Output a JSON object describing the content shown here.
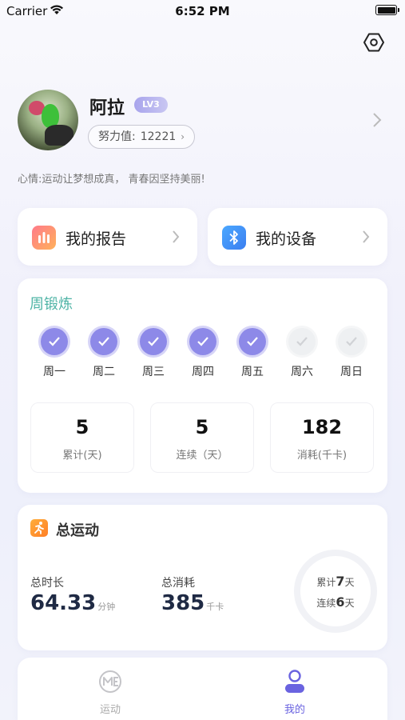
{
  "status_bar": {
    "carrier": "Carrier",
    "time": "6:52 PM"
  },
  "profile": {
    "name": "阿拉",
    "level": "LV3",
    "effort_label": "努力值:",
    "effort_value": "12221",
    "mood": "心情:运动让梦想成真， 青春因坚持美丽!"
  },
  "quick_actions": [
    {
      "label": "我的报告",
      "icon": "bar-chart-icon"
    },
    {
      "label": "我的设备",
      "icon": "bluetooth-icon"
    }
  ],
  "week": {
    "title": "周锻炼",
    "days": [
      {
        "label": "周一",
        "done": true
      },
      {
        "label": "周二",
        "done": true
      },
      {
        "label": "周三",
        "done": true
      },
      {
        "label": "周四",
        "done": true
      },
      {
        "label": "周五",
        "done": true
      },
      {
        "label": "周六",
        "done": false
      },
      {
        "label": "周日",
        "done": false
      }
    ],
    "stats": [
      {
        "value": "5",
        "label": "累计(天)"
      },
      {
        "value": "5",
        "label": "连续（天）"
      },
      {
        "value": "182",
        "label": "消耗(千卡)"
      }
    ]
  },
  "total": {
    "title": "总运动",
    "duration_label": "总时长",
    "duration_value": "64.33",
    "duration_unit": "分钟",
    "calories_label": "总消耗",
    "calories_value": "385",
    "calories_unit": "千卡",
    "ring": {
      "cumulative_prefix": "累计",
      "cumulative_value": "7",
      "cumulative_suffix": "天",
      "streak_prefix": "连续",
      "streak_value": "6",
      "streak_suffix": "天"
    }
  },
  "tabbar": {
    "items": [
      {
        "label": "运动",
        "active": false
      },
      {
        "label": "我的",
        "active": true
      }
    ]
  },
  "colors": {
    "accent": "#6a63e0",
    "week_title": "#4fb4a6",
    "check_done": "#8d89e8"
  }
}
